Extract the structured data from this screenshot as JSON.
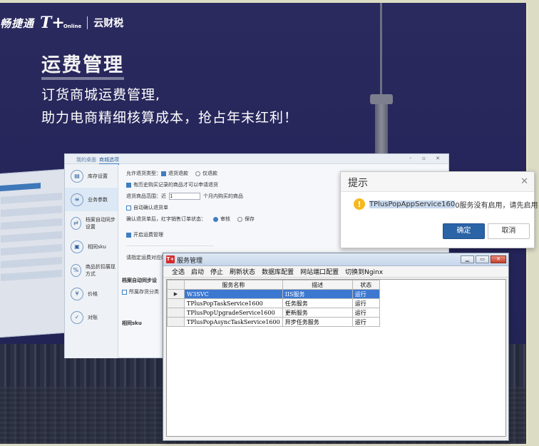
{
  "banner": {
    "logo_cn": "畅捷通",
    "logo_t": "T+",
    "logo_online": "Online",
    "logo_cloud": "云财税",
    "hero_title": "运费管理",
    "hero_sub1": "订货商城运费管理,",
    "hero_sub2": "助力电商精细核算成本，抢占年末红利！"
  },
  "app_shot": {
    "tabs": [
      "我的桌面",
      "商城选项"
    ],
    "sidebar": [
      "库存设置",
      "业务参数",
      "档案自动同步设置",
      "相同sku",
      "商品折扣展现方式",
      "价格",
      "对账"
    ],
    "lines": {
      "refund_type": "允许退货类型：",
      "refund_opt1": "退货退款",
      "refund_opt2": "仅退款",
      "history_only": "有历史购买记录的商品才可以申请退货",
      "range_prefix": "退货商品范围：近",
      "range_value": "1",
      "range_suffix": "个月内购买的商品",
      "auto_confirm": "自动确认退货单",
      "confirm_label": "确认退货单后，红字销售订单状态：",
      "confirm_opt1": "审核",
      "confirm_opt2": "保存",
      "freight_enable": "开启运费管理",
      "freight_line": "请指定运费对应的",
      "auto_sync": "档案自动同步设",
      "sync_item": "所属存货分类",
      "same_sku": "相同sku"
    }
  },
  "hint_dialog": {
    "title": "提示",
    "message_highlight": "TPlusPopAppService160",
    "message_rest": "0服务没有启用，请先启用！",
    "ok_label": "确定",
    "cancel_label": "取消"
  },
  "service_manager": {
    "app_icon": "T+",
    "title": "服务管理",
    "menu": [
      "全选",
      "启动",
      "停止",
      "刷新状态",
      "数据库配置",
      "网站端口配置",
      "切换到Nginx"
    ],
    "columns": [
      "服务名称",
      "描述",
      "状态"
    ],
    "rows": [
      {
        "name": "W3SVC",
        "desc": "IIS服务",
        "state": "运行"
      },
      {
        "name": "TPlusPopTaskService1600",
        "desc": "任务服务",
        "state": "运行"
      },
      {
        "name": "TPlusPopUpgradeService1600",
        "desc": "更新服务",
        "state": "运行"
      },
      {
        "name": "TPlusPopAsyncTaskService1600",
        "desc": "异步任务服务",
        "state": "运行"
      }
    ]
  }
}
